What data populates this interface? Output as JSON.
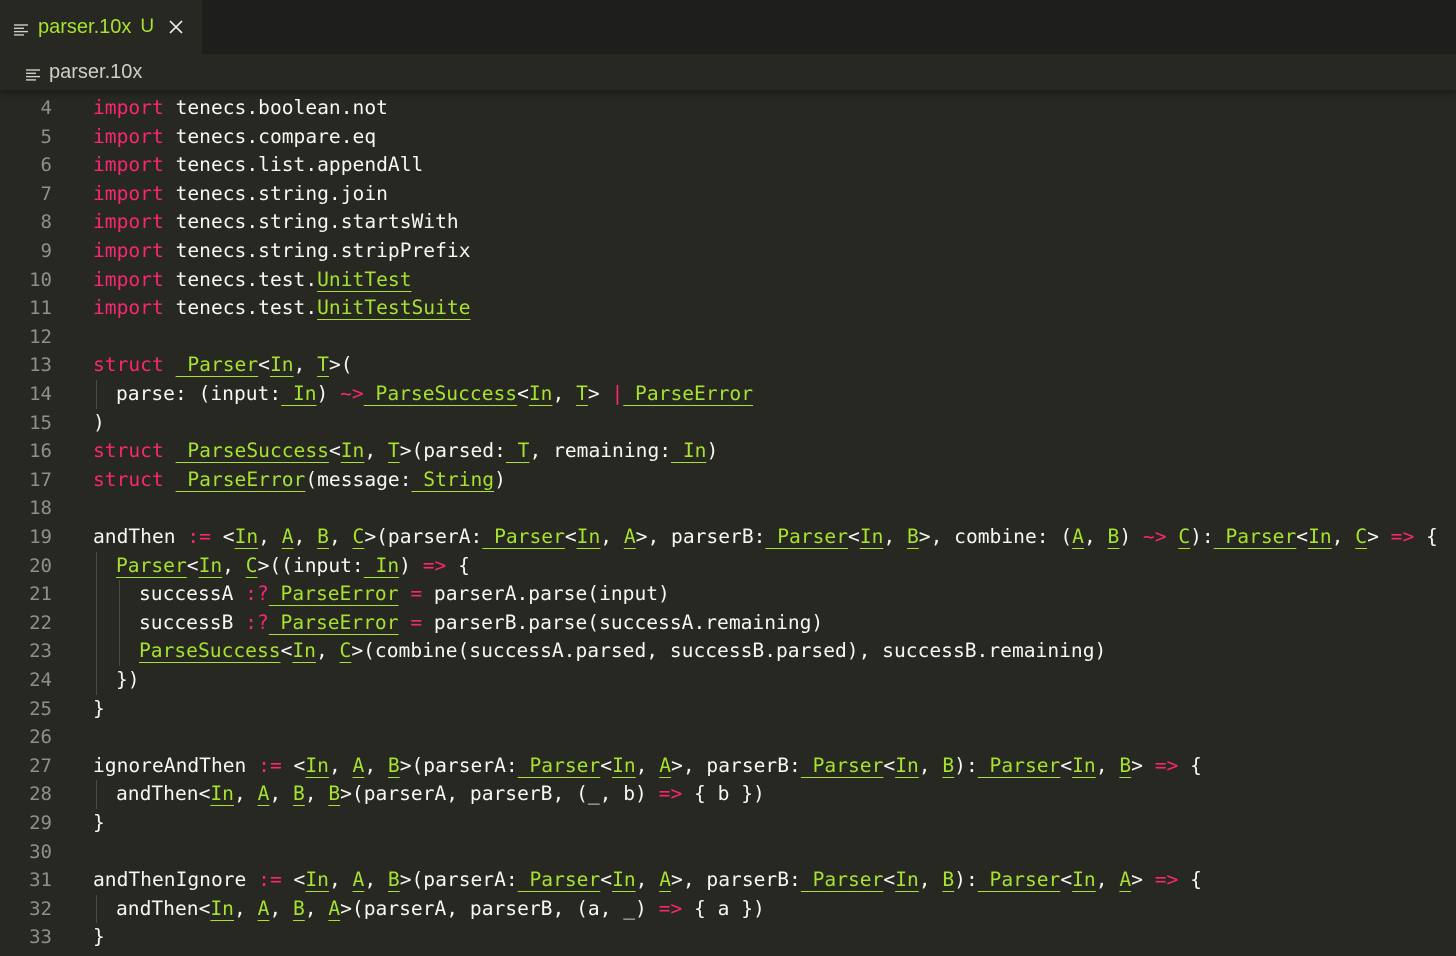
{
  "tab": {
    "title": "parser.10x",
    "status": "U",
    "icon": "file-lines-icon",
    "close_icon": "close-icon"
  },
  "breadcrumb": {
    "label": "parser.10x",
    "icon": "file-lines-icon"
  },
  "colors": {
    "keyword": "#f92672",
    "type": "#a6e22e",
    "text": "#f8f8f2",
    "line_number": "#90908a",
    "background": "#272822"
  },
  "editor": {
    "lines": [
      {
        "n": "4",
        "indent": 0,
        "tokens": [
          [
            "kw",
            "import"
          ],
          [
            "",
            "tenecs.boolean.not"
          ]
        ]
      },
      {
        "n": "5",
        "indent": 0,
        "tokens": [
          [
            "kw",
            "import"
          ],
          [
            "",
            "tenecs.compare.eq"
          ]
        ]
      },
      {
        "n": "6",
        "indent": 0,
        "tokens": [
          [
            "kw",
            "import"
          ],
          [
            "",
            "tenecs.list.appendAll"
          ]
        ]
      },
      {
        "n": "7",
        "indent": 0,
        "tokens": [
          [
            "kw",
            "import"
          ],
          [
            "",
            "tenecs.string.join"
          ]
        ]
      },
      {
        "n": "8",
        "indent": 0,
        "tokens": [
          [
            "kw",
            "import"
          ],
          [
            "",
            "tenecs.string.startsWith"
          ]
        ]
      },
      {
        "n": "9",
        "indent": 0,
        "tokens": [
          [
            "kw",
            "import"
          ],
          [
            "",
            "tenecs.string.stripPrefix"
          ]
        ]
      },
      {
        "n": "10",
        "indent": 0,
        "tokens": [
          [
            "kw",
            "import"
          ],
          [
            "",
            "tenecs.test."
          ],
          [
            "ty",
            "UnitTest"
          ]
        ]
      },
      {
        "n": "11",
        "indent": 0,
        "tokens": [
          [
            "kw",
            "import"
          ],
          [
            "",
            "tenecs.test."
          ],
          [
            "ty",
            "UnitTestSuite"
          ]
        ]
      },
      {
        "n": "12",
        "indent": 0,
        "tokens": []
      },
      {
        "n": "13",
        "indent": 0,
        "tokens": [
          [
            "kw",
            "struct"
          ],
          [
            "ty",
            " Parser"
          ],
          [
            "",
            "<"
          ],
          [
            "ty",
            "In"
          ],
          [
            "",
            ", "
          ],
          [
            "ty",
            "T"
          ],
          [
            "",
            ">("
          ]
        ]
      },
      {
        "n": "14",
        "indent": 1,
        "tokens": [
          [
            "",
            "parse: (input:"
          ],
          [
            "ty",
            " In"
          ],
          [
            "",
            ") "
          ],
          [
            "op",
            "~>"
          ],
          [
            "ty",
            " ParseSuccess"
          ],
          [
            "",
            "<"
          ],
          [
            "ty",
            "In"
          ],
          [
            "",
            ", "
          ],
          [
            "ty",
            "T"
          ],
          [
            "",
            "> "
          ],
          [
            "op",
            "|"
          ],
          [
            "ty",
            " ParseError"
          ]
        ]
      },
      {
        "n": "15",
        "indent": 0,
        "tokens": [
          [
            "",
            ")"
          ]
        ]
      },
      {
        "n": "16",
        "indent": 0,
        "tokens": [
          [
            "kw",
            "struct"
          ],
          [
            "ty",
            " ParseSuccess"
          ],
          [
            "",
            "<"
          ],
          [
            "ty",
            "In"
          ],
          [
            "",
            ", "
          ],
          [
            "ty",
            "T"
          ],
          [
            "",
            ">(parsed:"
          ],
          [
            "ty",
            " T"
          ],
          [
            "",
            ", remaining:"
          ],
          [
            "ty",
            " In"
          ],
          [
            "",
            ")"
          ]
        ]
      },
      {
        "n": "17",
        "indent": 0,
        "tokens": [
          [
            "kw",
            "struct"
          ],
          [
            "ty",
            " ParseError"
          ],
          [
            "",
            "(message:"
          ],
          [
            "ty",
            " String"
          ],
          [
            "",
            ")"
          ]
        ]
      },
      {
        "n": "18",
        "indent": 0,
        "tokens": []
      },
      {
        "n": "19",
        "indent": 0,
        "tokens": [
          [
            "",
            "andThen "
          ],
          [
            "op",
            ":="
          ],
          [
            "",
            " <"
          ],
          [
            "ty",
            "In"
          ],
          [
            "",
            ", "
          ],
          [
            "ty",
            "A"
          ],
          [
            "",
            ", "
          ],
          [
            "ty",
            "B"
          ],
          [
            "",
            ", "
          ],
          [
            "ty",
            "C"
          ],
          [
            "",
            ">(parserA:"
          ],
          [
            "ty",
            " Parser"
          ],
          [
            "",
            "<"
          ],
          [
            "ty",
            "In"
          ],
          [
            "",
            ", "
          ],
          [
            "ty",
            "A"
          ],
          [
            "",
            ">, parserB:"
          ],
          [
            "ty",
            " Parser"
          ],
          [
            "",
            "<"
          ],
          [
            "ty",
            "In"
          ],
          [
            "",
            ", "
          ],
          [
            "ty",
            "B"
          ],
          [
            "",
            ">, combine: ("
          ],
          [
            "ty",
            "A"
          ],
          [
            "",
            ", "
          ],
          [
            "ty",
            "B"
          ],
          [
            "",
            ") "
          ],
          [
            "op",
            "~>"
          ],
          [
            "",
            " "
          ],
          [
            "ty",
            "C"
          ],
          [
            "",
            "):"
          ],
          [
            "ty",
            " Parser"
          ],
          [
            "",
            "<"
          ],
          [
            "ty",
            "In"
          ],
          [
            "",
            ", "
          ],
          [
            "ty",
            "C"
          ],
          [
            "",
            "> "
          ],
          [
            "op",
            "=>"
          ],
          [
            "",
            " {"
          ]
        ]
      },
      {
        "n": "20",
        "indent": 1,
        "tokens": [
          [
            "ty",
            "Parser"
          ],
          [
            "",
            "<"
          ],
          [
            "ty",
            "In"
          ],
          [
            "",
            ", "
          ],
          [
            "ty",
            "C"
          ],
          [
            "",
            ">((input:"
          ],
          [
            "ty",
            " In"
          ],
          [
            "",
            ") "
          ],
          [
            "op",
            "=>"
          ],
          [
            "",
            " {"
          ]
        ]
      },
      {
        "n": "21",
        "indent": 2,
        "tokens": [
          [
            "",
            "successA "
          ],
          [
            "op",
            ":?"
          ],
          [
            "ty",
            " ParseError"
          ],
          [
            "",
            "",
            " "
          ],
          [
            "op",
            "="
          ],
          [
            "",
            " parserA.parse(input)"
          ]
        ]
      },
      {
        "n": "22",
        "indent": 2,
        "tokens": [
          [
            "",
            "successB "
          ],
          [
            "op",
            ":?"
          ],
          [
            "ty",
            " ParseError"
          ],
          [
            "",
            " "
          ],
          [
            "op",
            "="
          ],
          [
            "",
            " parserB.parse(successA.remaining)"
          ]
        ]
      },
      {
        "n": "23",
        "indent": 2,
        "tokens": [
          [
            "ty",
            "ParseSuccess"
          ],
          [
            "",
            "<"
          ],
          [
            "ty",
            "In"
          ],
          [
            "",
            ", "
          ],
          [
            "ty",
            "C"
          ],
          [
            "",
            ">(combine(successA.parsed, successB.parsed), successB.remaining)"
          ]
        ]
      },
      {
        "n": "24",
        "indent": 1,
        "tokens": [
          [
            "",
            "})"
          ]
        ]
      },
      {
        "n": "25",
        "indent": 0,
        "tokens": [
          [
            "",
            "}"
          ]
        ]
      },
      {
        "n": "26",
        "indent": 0,
        "tokens": []
      },
      {
        "n": "27",
        "indent": 0,
        "tokens": [
          [
            "",
            "ignoreAndThen "
          ],
          [
            "op",
            ":="
          ],
          [
            "",
            " <"
          ],
          [
            "ty",
            "In"
          ],
          [
            "",
            ", "
          ],
          [
            "ty",
            "A"
          ],
          [
            "",
            ", "
          ],
          [
            "ty",
            "B"
          ],
          [
            "",
            ">(parserA:"
          ],
          [
            "ty",
            " Parser"
          ],
          [
            "",
            "<"
          ],
          [
            "ty",
            "In"
          ],
          [
            "",
            ", "
          ],
          [
            "ty",
            "A"
          ],
          [
            "",
            ">, parserB:"
          ],
          [
            "ty",
            " Parser"
          ],
          [
            "",
            "<"
          ],
          [
            "ty",
            "In"
          ],
          [
            "",
            ", "
          ],
          [
            "ty",
            "B"
          ],
          [
            "",
            "):"
          ],
          [
            "ty",
            " Parser"
          ],
          [
            "",
            "<"
          ],
          [
            "ty",
            "In"
          ],
          [
            "",
            ", "
          ],
          [
            "ty",
            "B"
          ],
          [
            "",
            "> "
          ],
          [
            "op",
            "=>"
          ],
          [
            "",
            " {"
          ]
        ]
      },
      {
        "n": "28",
        "indent": 1,
        "tokens": [
          [
            "",
            "andThen<"
          ],
          [
            "ty",
            "In"
          ],
          [
            "",
            ", "
          ],
          [
            "ty",
            "A"
          ],
          [
            "",
            ", "
          ],
          [
            "ty",
            "B"
          ],
          [
            "",
            ", "
          ],
          [
            "ty",
            "B"
          ],
          [
            "",
            ">(parserA, parserB, (_, b) "
          ],
          [
            "op",
            "=>"
          ],
          [
            "",
            " { b })"
          ]
        ]
      },
      {
        "n": "29",
        "indent": 0,
        "tokens": [
          [
            "",
            "}"
          ]
        ]
      },
      {
        "n": "30",
        "indent": 0,
        "tokens": []
      },
      {
        "n": "31",
        "indent": 0,
        "tokens": [
          [
            "",
            "andThenIgnore "
          ],
          [
            "op",
            ":="
          ],
          [
            "",
            " <"
          ],
          [
            "ty",
            "In"
          ],
          [
            "",
            ", "
          ],
          [
            "ty",
            "A"
          ],
          [
            "",
            ", "
          ],
          [
            "ty",
            "B"
          ],
          [
            "",
            ">(parserA:"
          ],
          [
            "ty",
            " Parser"
          ],
          [
            "",
            "<"
          ],
          [
            "ty",
            "In"
          ],
          [
            "",
            ", "
          ],
          [
            "ty",
            "A"
          ],
          [
            "",
            ">, parserB:"
          ],
          [
            "ty",
            " Parser"
          ],
          [
            "",
            "<"
          ],
          [
            "ty",
            "In"
          ],
          [
            "",
            ", "
          ],
          [
            "ty",
            "B"
          ],
          [
            "",
            "):"
          ],
          [
            "ty",
            " Parser"
          ],
          [
            "",
            "<"
          ],
          [
            "ty",
            "In"
          ],
          [
            "",
            ", "
          ],
          [
            "ty",
            "A"
          ],
          [
            "",
            "> "
          ],
          [
            "op",
            "=>"
          ],
          [
            "",
            " {"
          ]
        ]
      },
      {
        "n": "32",
        "indent": 1,
        "tokens": [
          [
            "",
            "andThen<"
          ],
          [
            "ty",
            "In"
          ],
          [
            "",
            ", "
          ],
          [
            "ty",
            "A"
          ],
          [
            "",
            ", "
          ],
          [
            "ty",
            "B"
          ],
          [
            "",
            ", "
          ],
          [
            "ty",
            "A"
          ],
          [
            "",
            ">(parserA, parserB, (a, _) "
          ],
          [
            "op",
            "=>"
          ],
          [
            "",
            " { a })"
          ]
        ]
      },
      {
        "n": "33",
        "indent": 0,
        "tokens": [
          [
            "",
            "}"
          ]
        ]
      }
    ]
  }
}
